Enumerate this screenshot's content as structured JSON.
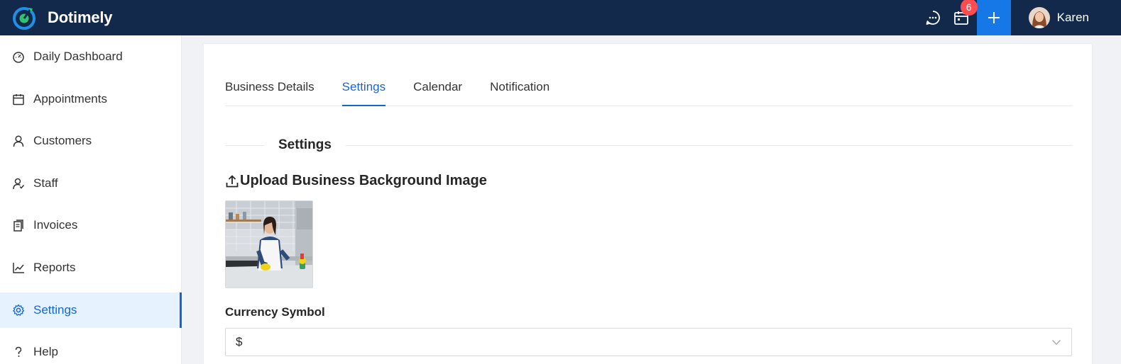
{
  "app": {
    "name": "Dotimely"
  },
  "topbar": {
    "notification_count": "6",
    "user_name": "Karen",
    "icons": [
      "chat-icon",
      "calendar-icon",
      "plus-icon"
    ]
  },
  "sidebar": {
    "items": [
      {
        "label": "Daily Dashboard",
        "icon": "dashboard-icon"
      },
      {
        "label": "Appointments",
        "icon": "calendar-icon"
      },
      {
        "label": "Customers",
        "icon": "user-icon"
      },
      {
        "label": "Staff",
        "icon": "staff-icon"
      },
      {
        "label": "Invoices",
        "icon": "invoice-icon"
      },
      {
        "label": "Reports",
        "icon": "chart-icon"
      },
      {
        "label": "Settings",
        "icon": "gear-icon",
        "active": true
      },
      {
        "label": "Help",
        "icon": "question-icon"
      }
    ]
  },
  "tabs": [
    {
      "label": "Business Details"
    },
    {
      "label": "Settings",
      "active": true
    },
    {
      "label": "Calendar"
    },
    {
      "label": "Notification"
    }
  ],
  "section": {
    "title": "Settings"
  },
  "upload": {
    "label": "Upload Business Background Image"
  },
  "currency": {
    "label": "Currency Symbol",
    "value": "$"
  },
  "colors": {
    "topbar": "#13294b",
    "accent": "#1565d8",
    "plus_button": "#1677e6",
    "badge": "#ff4d4f",
    "active_bg": "#e6f3ff"
  }
}
